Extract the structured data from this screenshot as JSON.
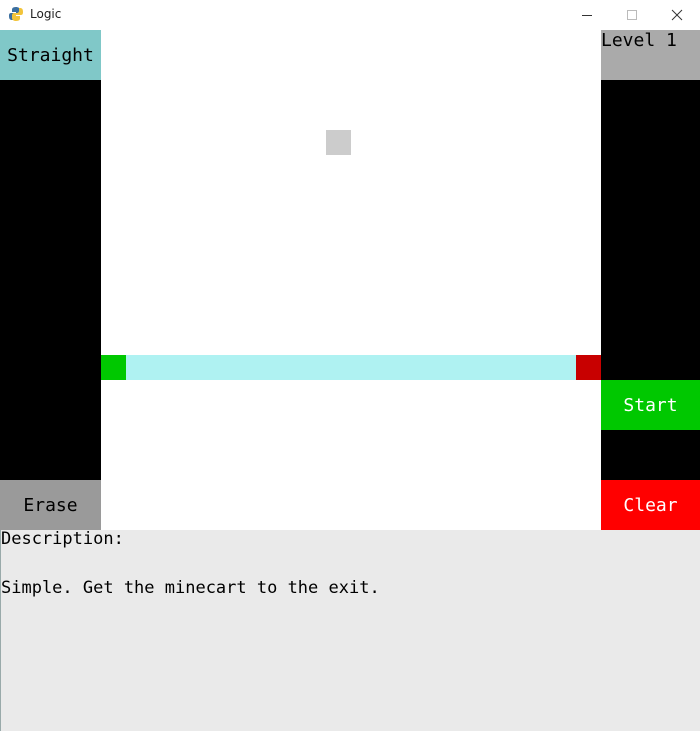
{
  "window": {
    "title": "Logic",
    "icon": "python-icon"
  },
  "left_panel": {
    "selected_tool_label": "Straight",
    "erase_label": "Erase"
  },
  "right_panel": {
    "level_label": "Level 1",
    "start_label": "Start",
    "clear_label": "Clear"
  },
  "board": {
    "grid_size": 20,
    "track": {
      "row": 13,
      "col_start": 1,
      "col_end": 18
    },
    "entrance": {
      "row": 13,
      "col": 0
    },
    "exit": {
      "row": 13,
      "col": 19
    },
    "hover_cell": {
      "row": 4,
      "col": 9
    },
    "colors": {
      "track": "#aff2f2",
      "entrance": "#00c800",
      "exit": "#c80000",
      "hover": "#cccccc"
    }
  },
  "description": {
    "heading": "Description:",
    "text": "Simple. Get the minecart to the exit."
  },
  "colors": {
    "selected_tool": "#80c8c8",
    "erase": "#9a9a9a",
    "level": "#aaaaaa",
    "start": "#00c800",
    "clear": "#ff0000",
    "description_bg": "#eaeaea"
  }
}
